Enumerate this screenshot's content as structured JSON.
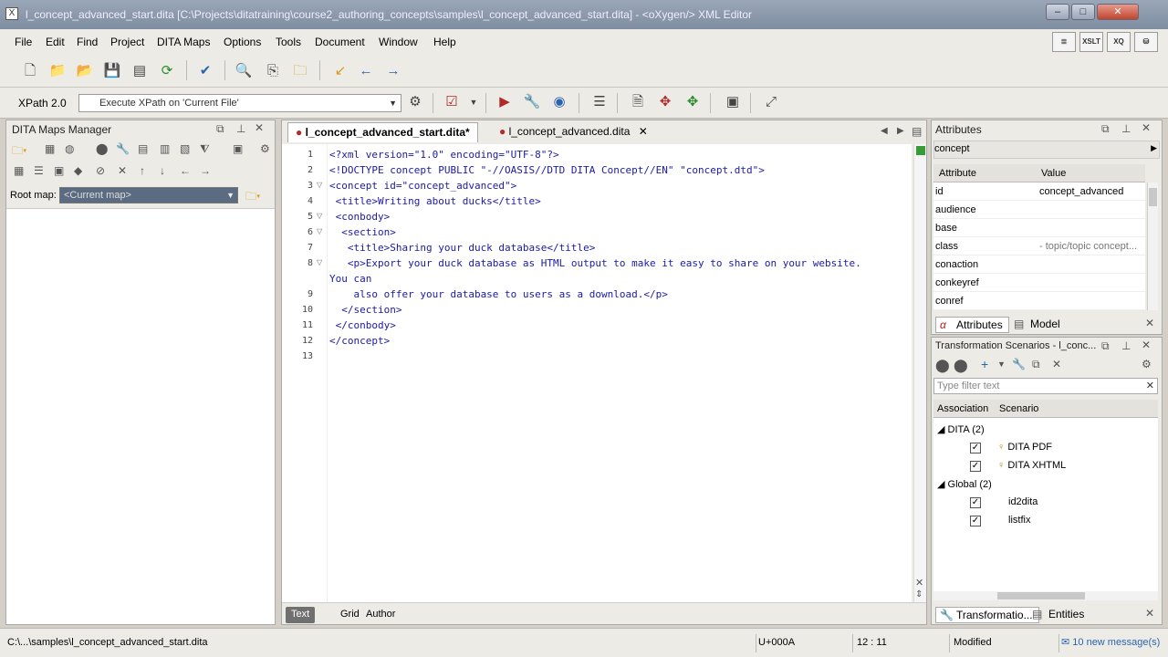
{
  "window": {
    "title": "l_concept_advanced_start.dita [C:\\Projects\\ditatraining\\course2_authoring_concepts\\samples\\l_concept_advanced_start.dita] - <oXygen/> XML Editor"
  },
  "menubar": [
    "File",
    "Edit",
    "Find",
    "Project",
    "DITA Maps",
    "Options",
    "Tools",
    "Document",
    "Window",
    "Help"
  ],
  "perspectives": [
    "",
    "XSLT",
    "XQ",
    ""
  ],
  "xpath": {
    "version_label": "XPath 2.0",
    "placeholder": "Execute XPath on 'Current File'"
  },
  "left_panel": {
    "title": "DITA Maps Manager",
    "root_map_label": "Root map:",
    "root_map_value": "<Current map>"
  },
  "editor": {
    "tabs": [
      {
        "label": "l_concept_advanced_start.dita*",
        "active": true
      },
      {
        "label": "l_concept_advanced.dita",
        "active": false
      }
    ],
    "line_numbers": [
      "1",
      "2",
      "3",
      "4",
      "5",
      "6",
      "7",
      "8",
      "9",
      "10",
      "11",
      "12",
      "13"
    ],
    "lines": [
      "<?xml version=\"1.0\" encoding=\"UTF-8\"?>",
      "<!DOCTYPE concept PUBLIC \"-//OASIS//DTD DITA Concept//EN\" \"concept.dtd\">",
      "<concept id=\"concept_advanced\">",
      " <title>Writing about ducks</title>",
      " <conbody>",
      "  <section>",
      "   <title>Sharing your duck database</title>",
      "   <p>Export your duck database as HTML output to make it easy to share on your website.",
      "You can",
      "    also offer your database to users as a download.</p>",
      "  </section>",
      " </conbody>",
      "</concept>"
    ],
    "mode_tabs": [
      "Text",
      "Grid",
      "Author"
    ]
  },
  "attributes_panel": {
    "title": "Attributes",
    "element": "concept",
    "col_attribute": "Attribute",
    "col_value": "Value",
    "rows": [
      {
        "name": "id",
        "value": "concept_advanced"
      },
      {
        "name": "audience",
        "value": ""
      },
      {
        "name": "base",
        "value": ""
      },
      {
        "name": "class",
        "value": "- topic/topic concept..."
      },
      {
        "name": "conaction",
        "value": ""
      },
      {
        "name": "conkeyref",
        "value": ""
      },
      {
        "name": "conref",
        "value": ""
      }
    ],
    "bottom_tabs": [
      "Attributes",
      "Model"
    ]
  },
  "transform_panel": {
    "title": "Transformation Scenarios - l_conc...",
    "filter_placeholder": "Type filter text",
    "col_association": "Association",
    "col_scenario": "Scenario",
    "groups": [
      {
        "label": "DITA (2)",
        "items": [
          "DITA PDF",
          "DITA XHTML"
        ]
      },
      {
        "label": "Global (2)",
        "items": [
          "id2dita",
          "listfix"
        ]
      }
    ],
    "bottom_tabs": [
      "Transformatio...",
      "Entities"
    ]
  },
  "statusbar": {
    "path": "C:\\...\\samples\\l_concept_advanced_start.dita",
    "unicode": "U+000A",
    "position": "12 : 11",
    "state": "Modified",
    "messages": "10 new message(s)"
  }
}
